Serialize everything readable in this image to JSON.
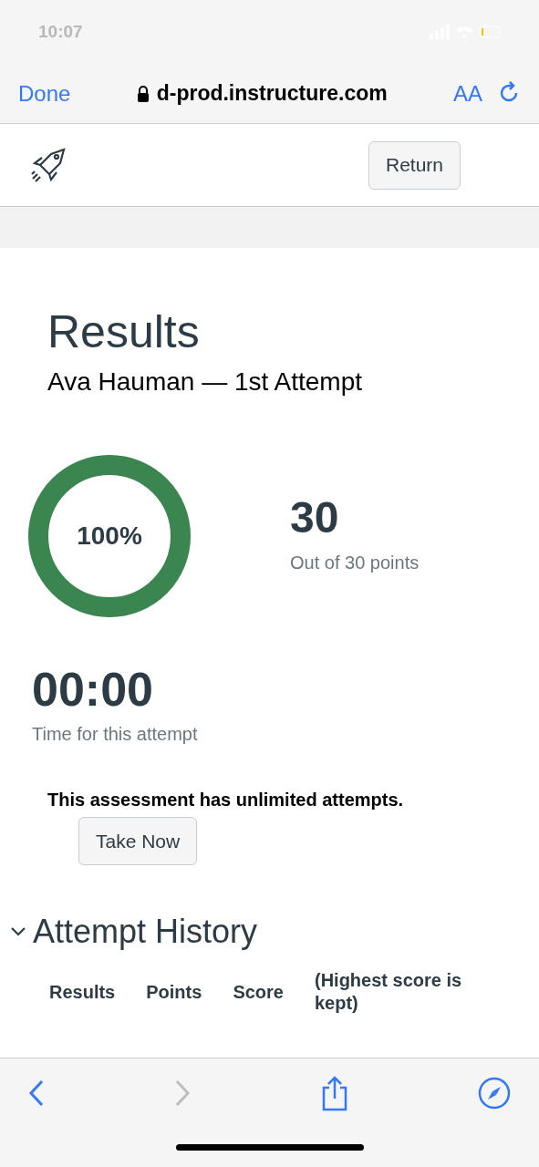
{
  "status_bar": {
    "time": "10:07"
  },
  "browser_bar": {
    "done": "Done",
    "url": "d-prod.instructure.com",
    "text_size": "AA"
  },
  "header": {
    "return_button": "Return"
  },
  "results": {
    "title": "Results",
    "subtitle": "Ava Hauman — 1st Attempt",
    "percent": "100%",
    "level": 1,
    "score": "30",
    "score_caption": "Out of 30 points",
    "time": "00:00",
    "time_caption": "Time for this attempt",
    "attempts_note": "This assessment has unlimited attempts.",
    "take_button": "Take Now"
  },
  "attempt_history": {
    "title": "Attempt History",
    "expanded": true,
    "columns": [
      "Results",
      "Points",
      "Score",
      "(Highest score is kept)"
    ]
  },
  "toolbar": {
    "forward_disabled": true
  }
}
